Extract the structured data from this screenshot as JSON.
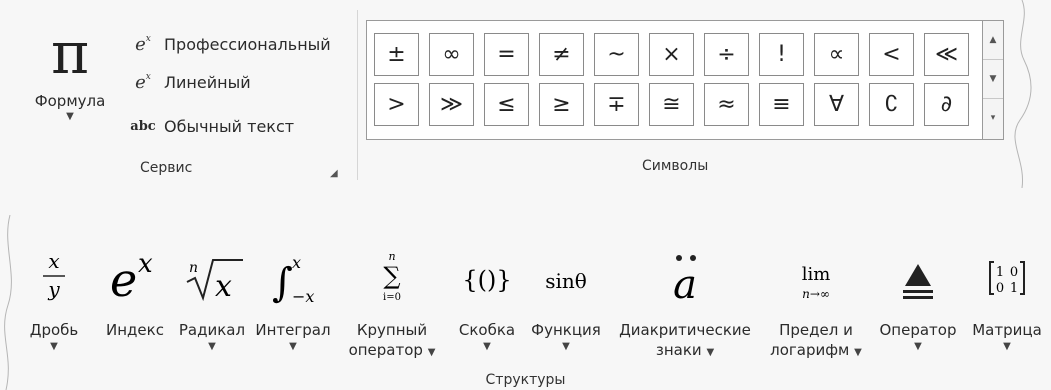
{
  "service": {
    "formula_glyph": "π",
    "formula_label": "Формула",
    "items": [
      {
        "icon": "professional-format-icon",
        "label": "Профессиональный"
      },
      {
        "icon": "linear-format-icon",
        "label": "Линейный"
      },
      {
        "icon": "abc-text-icon",
        "label": "Обычный текст"
      }
    ],
    "group_label": "Сервис"
  },
  "symbols": {
    "row1": [
      "±",
      "∞",
      "=",
      "≠",
      "~",
      "×",
      "÷",
      "!",
      "∝",
      "<",
      "≪"
    ],
    "row2": [
      ">",
      "≫",
      "≤",
      "≥",
      "∓",
      "≅",
      "≈",
      "≡",
      "∀",
      "∁",
      "∂"
    ],
    "group_label": "Символы"
  },
  "structures": {
    "items": [
      {
        "label": "Дробь",
        "glyph": "fraction"
      },
      {
        "label": "Индекс",
        "glyph": "script"
      },
      {
        "label": "Радикал",
        "glyph": "radical"
      },
      {
        "label": "Интеграл",
        "glyph": "integral"
      },
      {
        "label_line1": "Крупный",
        "label_line2": "оператор",
        "glyph": "large-operator"
      },
      {
        "label": "Скобка",
        "glyph": "bracket"
      },
      {
        "label": "Функция",
        "glyph": "function"
      },
      {
        "label_line1": "Диакритические",
        "label_line2": "знаки",
        "glyph": "accent"
      },
      {
        "label_line1": "Предел и",
        "label_line2": "логарифм",
        "glyph": "limit"
      },
      {
        "label": "Оператор",
        "glyph": "operator"
      },
      {
        "label": "Матрица",
        "glyph": "matrix"
      }
    ],
    "group_label": "Структуры"
  }
}
